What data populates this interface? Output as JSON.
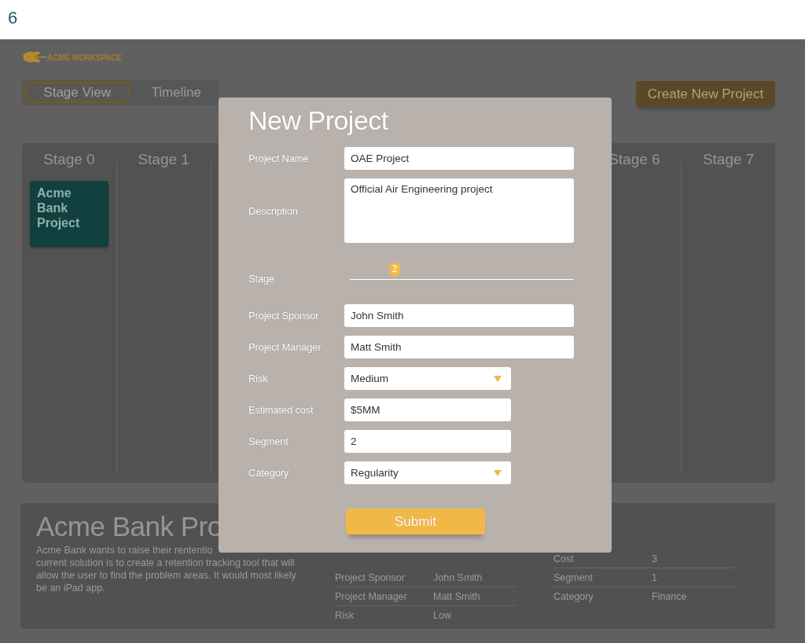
{
  "top_bar": {
    "page_number": "6"
  },
  "header": {
    "logo_text": "ACME WORKSPACE",
    "create_button": "Create New Project"
  },
  "view_tabs": [
    {
      "label": "Stage View",
      "selected": true
    },
    {
      "label": "Timeline",
      "selected": false
    }
  ],
  "board": {
    "left_columns": [
      {
        "title": "Stage 0",
        "cards": [
          {
            "title": "Acme Bank Project"
          }
        ]
      },
      {
        "title": "Stage 1"
      }
    ],
    "right_columns": [
      {
        "title": "Stage 6"
      },
      {
        "title": "Stage 7"
      }
    ]
  },
  "detail_panel": {
    "title": "Acme Bank Pro",
    "description_lines": [
      "Acme Bank wants to raise their rententio",
      "current solution is to create a retention tracking tool that will",
      "allow the user to find the problem areas. It would most likely",
      "be an iPad app."
    ],
    "left_table": [
      {
        "label": "Project Sponsor",
        "value": "John Smith"
      },
      {
        "label": "Project Manager",
        "value": "Matt Smith"
      },
      {
        "label": "Risk",
        "value": "Low"
      }
    ],
    "right_table": [
      {
        "label": "Cost",
        "value": "3"
      },
      {
        "label": "Segment",
        "value": "1"
      },
      {
        "label": "Category",
        "value": "Finance"
      }
    ]
  },
  "modal": {
    "title": "New Project",
    "fields": [
      {
        "kind": "text",
        "label": "Project Name",
        "value": "OAE Project"
      },
      {
        "kind": "textarea",
        "label": "Description",
        "value": "Official Air Engineering project"
      },
      {
        "kind": "slider",
        "label": "Stage",
        "value": "2",
        "level": 0.2
      },
      {
        "kind": "text",
        "label": "Project Sponsor",
        "value": "John Smith"
      },
      {
        "kind": "text",
        "label": "Project Manager",
        "value": "Matt Smith"
      },
      {
        "kind": "select",
        "label": "Risk",
        "value": "Medium"
      },
      {
        "kind": "short",
        "label": "Estimated cost",
        "value": "$5MM"
      },
      {
        "kind": "short",
        "label": "Segment",
        "value": "2"
      },
      {
        "kind": "select",
        "label": "Category",
        "value": "Regularity"
      }
    ],
    "submit_button": "Submit"
  }
}
